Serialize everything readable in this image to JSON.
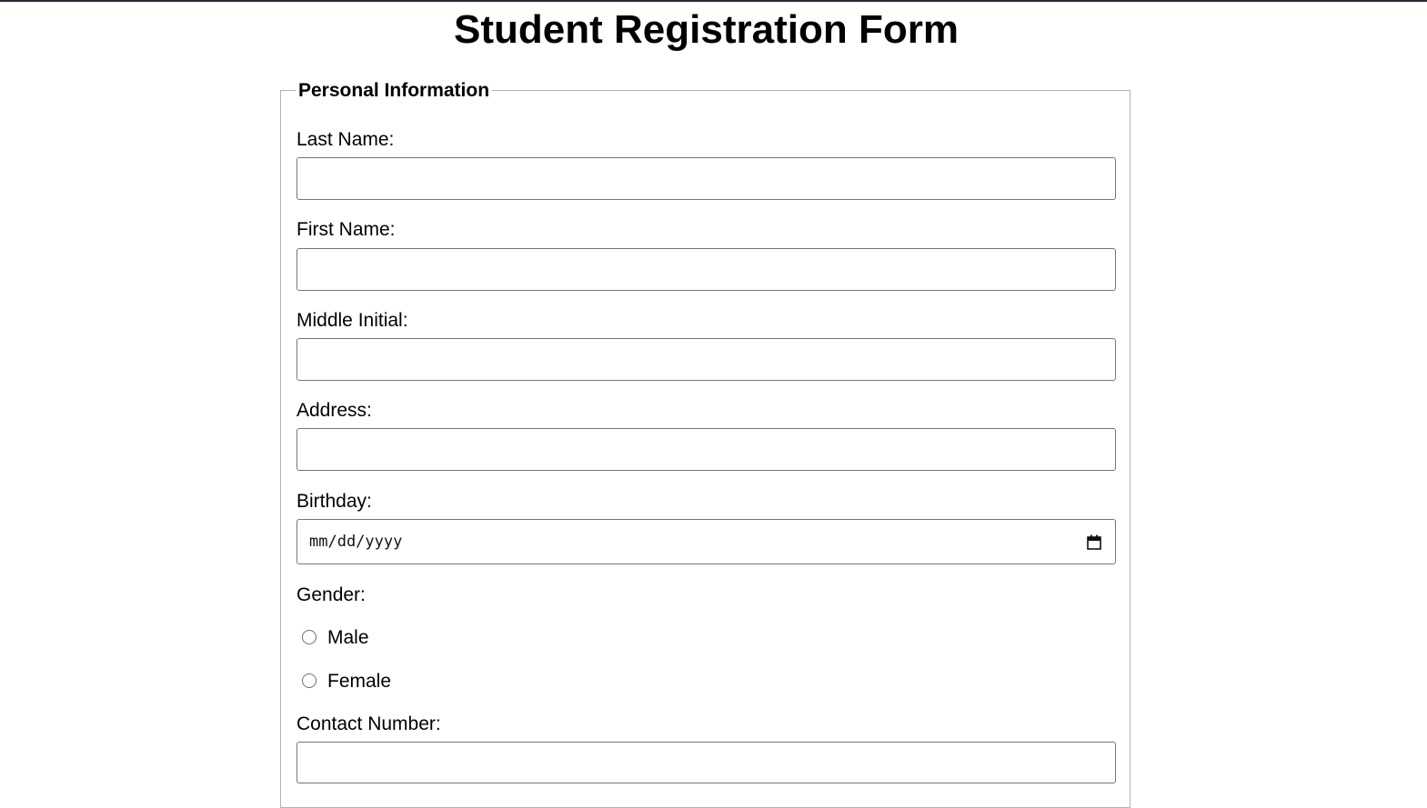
{
  "page": {
    "title": "Student Registration Form"
  },
  "personal_info": {
    "legend": "Personal Information",
    "last_name_label": "Last Name:",
    "last_name_value": "",
    "first_name_label": "First Name:",
    "first_name_value": "",
    "middle_initial_label": "Middle Initial:",
    "middle_initial_value": "",
    "address_label": "Address:",
    "address_value": "",
    "birthday_label": "Birthday:",
    "birthday_placeholder": "mm/dd/yyyy",
    "gender_label": "Gender:",
    "gender_options": [
      {
        "label": "Male",
        "checked": false
      },
      {
        "label": "Female",
        "checked": false
      }
    ],
    "contact_number_label": "Contact Number:",
    "contact_number_value": ""
  },
  "icons": {
    "calendar": "calendar-icon"
  },
  "colors": {
    "top_rule": "#1f2d3d",
    "input_border": "#767676",
    "fieldset_border": "#b3b3b3"
  }
}
